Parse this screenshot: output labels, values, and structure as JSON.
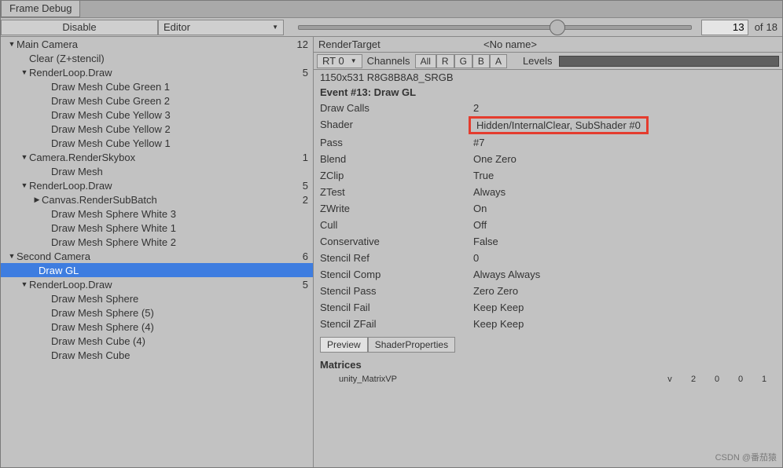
{
  "window": {
    "title": "Frame Debug"
  },
  "toolbar": {
    "disable_label": "Disable",
    "target_label": "Editor",
    "slider_value": "13",
    "slider_max": "18",
    "of_label": "of"
  },
  "tree": [
    {
      "indent": 8,
      "arrow": "▼",
      "label": "Main Camera",
      "count": "12"
    },
    {
      "indent": 24,
      "arrow": "",
      "label": "Clear (Z+stencil)",
      "count": ""
    },
    {
      "indent": 24,
      "arrow": "▼",
      "label": "RenderLoop.Draw",
      "count": "5"
    },
    {
      "indent": 52,
      "arrow": "",
      "label": "Draw Mesh Cube Green 1",
      "count": ""
    },
    {
      "indent": 52,
      "arrow": "",
      "label": "Draw Mesh Cube Green 2",
      "count": ""
    },
    {
      "indent": 52,
      "arrow": "",
      "label": "Draw Mesh Cube Yellow 3",
      "count": ""
    },
    {
      "indent": 52,
      "arrow": "",
      "label": "Draw Mesh Cube Yellow 2",
      "count": ""
    },
    {
      "indent": 52,
      "arrow": "",
      "label": "Draw Mesh Cube Yellow 1",
      "count": ""
    },
    {
      "indent": 24,
      "arrow": "▼",
      "label": "Camera.RenderSkybox",
      "count": "1"
    },
    {
      "indent": 52,
      "arrow": "",
      "label": "Draw Mesh",
      "count": ""
    },
    {
      "indent": 24,
      "arrow": "▼",
      "label": "RenderLoop.Draw",
      "count": "5"
    },
    {
      "indent": 40,
      "arrow": "▶",
      "label": "Canvas.RenderSubBatch",
      "count": "2"
    },
    {
      "indent": 52,
      "arrow": "",
      "label": "Draw Mesh Sphere White 3",
      "count": ""
    },
    {
      "indent": 52,
      "arrow": "",
      "label": "Draw Mesh Sphere White 1",
      "count": ""
    },
    {
      "indent": 52,
      "arrow": "",
      "label": "Draw Mesh Sphere White 2",
      "count": ""
    },
    {
      "indent": 8,
      "arrow": "▼",
      "label": "Second Camera",
      "count": "6"
    },
    {
      "indent": 36,
      "arrow": "",
      "label": "Draw GL",
      "count": "",
      "selected": true
    },
    {
      "indent": 24,
      "arrow": "▼",
      "label": "RenderLoop.Draw",
      "count": "5"
    },
    {
      "indent": 52,
      "arrow": "",
      "label": "Draw Mesh Sphere",
      "count": ""
    },
    {
      "indent": 52,
      "arrow": "",
      "label": "Draw Mesh Sphere (5)",
      "count": ""
    },
    {
      "indent": 52,
      "arrow": "",
      "label": "Draw Mesh Sphere (4)",
      "count": ""
    },
    {
      "indent": 52,
      "arrow": "",
      "label": "Draw Mesh Cube (4)",
      "count": ""
    },
    {
      "indent": 52,
      "arrow": "",
      "label": "Draw Mesh Cube",
      "count": ""
    }
  ],
  "details": {
    "render_target_label": "RenderTarget",
    "render_target_value": "<No name>",
    "rt_dropdown": "RT 0",
    "channels_label": "Channels",
    "channels": [
      "All",
      "R",
      "G",
      "B",
      "A"
    ],
    "levels_label": "Levels",
    "resolution": "1150x531 R8G8B8A8_SRGB",
    "event_title": "Event #13: Draw GL",
    "props": [
      {
        "label": "Draw Calls",
        "value": "2"
      },
      {
        "label": "Shader",
        "value": "Hidden/InternalClear, SubShader #0",
        "highlight": true
      },
      {
        "label": "Pass",
        "value": "#7"
      },
      {
        "label": "Blend",
        "value": "One Zero"
      },
      {
        "label": "ZClip",
        "value": "True"
      },
      {
        "label": "ZTest",
        "value": "Always"
      },
      {
        "label": "ZWrite",
        "value": "On"
      },
      {
        "label": "Cull",
        "value": "Off"
      },
      {
        "label": "Conservative",
        "value": "False"
      },
      {
        "label": "Stencil Ref",
        "value": "0"
      },
      {
        "label": "Stencil Comp",
        "value": "Always Always"
      },
      {
        "label": "Stencil Pass",
        "value": "Zero Zero"
      },
      {
        "label": "Stencil Fail",
        "value": "Keep Keep"
      },
      {
        "label": "Stencil ZFail",
        "value": "Keep Keep"
      }
    ],
    "sub_tabs": [
      "Preview",
      "ShaderProperties"
    ],
    "matrices_label": "Matrices",
    "matrix_name": "unity_MatrixVP",
    "matrix_row": [
      "v",
      "2",
      "0",
      "0",
      "1"
    ]
  },
  "watermark": "CSDN @番茄猿"
}
